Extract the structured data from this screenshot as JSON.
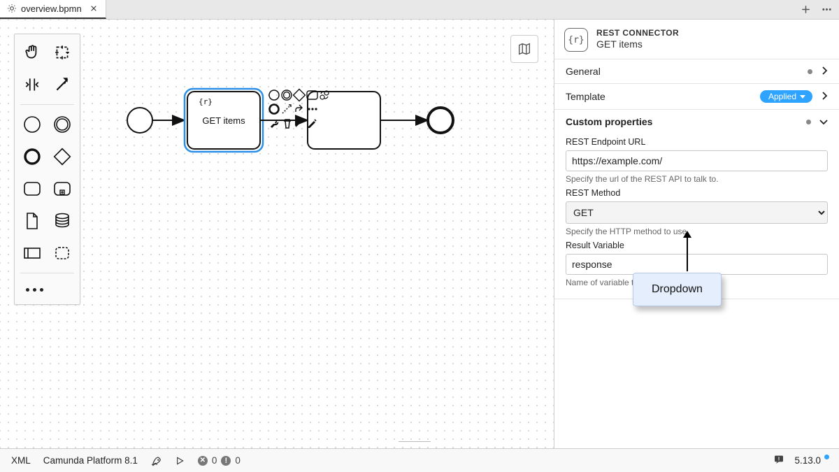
{
  "tab": {
    "filename": "overview.bpmn"
  },
  "task_label": "GET items",
  "properties": {
    "header": {
      "kind": "REST CONNECTOR",
      "name": "GET items",
      "icon_text": "{r}"
    },
    "sections": {
      "general_label": "General",
      "template_label": "Template",
      "template_badge": "Applied",
      "custom_label": "Custom properties"
    },
    "fields": {
      "url_label": "REST Endpoint URL",
      "url_value": "https://example.com/",
      "url_hint": "Specify the url of the REST API to talk to.",
      "method_label": "REST Method",
      "method_value": "GET",
      "method_hint": "Specify the HTTP method to use.",
      "result_label": "Result Variable",
      "result_value": "response",
      "result_hint": "Name of variable to                                                 n."
    }
  },
  "annotation": {
    "text": "Dropdown"
  },
  "status": {
    "xml": "XML",
    "engine": "Camunda Platform 8.1",
    "errors": 0,
    "warnings": 0,
    "version": "5.13.0"
  }
}
